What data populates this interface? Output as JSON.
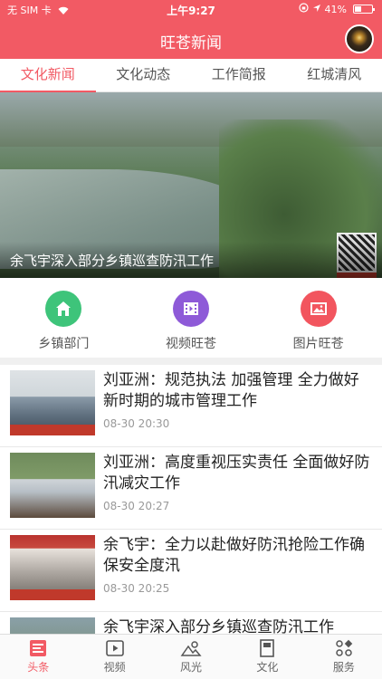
{
  "status_bar": {
    "carrier": "无 SIM 卡",
    "time": "上午9:27",
    "battery": "41%",
    "battery_level": 0.41
  },
  "header": {
    "title": "旺苍新闻"
  },
  "tabs": [
    {
      "label": "文化新闻",
      "active": true
    },
    {
      "label": "文化动态",
      "active": false
    },
    {
      "label": "工作简报",
      "active": false
    },
    {
      "label": "红城清风",
      "active": false
    }
  ],
  "hero": {
    "caption": "余飞宇深入部分乡镇巡查防汛工作"
  },
  "quick_links": [
    {
      "label": "乡镇部门",
      "color": "#3ec47a",
      "icon": "home-icon"
    },
    {
      "label": "视频旺苍",
      "color": "#8e5ad8",
      "icon": "film-icon"
    },
    {
      "label": "图片旺苍",
      "color": "#f2555e",
      "icon": "image-icon"
    }
  ],
  "news": [
    {
      "title": "刘亚洲：规范执法 加强管理 全力做好新时期的城市管理工作",
      "time": "08-30 20:30"
    },
    {
      "title": "刘亚洲：高度重视压实责任  全面做好防汛减灾工作",
      "time": "08-30 20:27"
    },
    {
      "title": "余飞宇：全力以赴做好防汛抢险工作确保安全度汛",
      "time": "08-30 20:25"
    },
    {
      "title": "余飞宇深入部分乡镇巡查防汛工作",
      "time": ""
    }
  ],
  "tabbar": [
    {
      "label": "头条",
      "icon": "headline-icon",
      "active": true
    },
    {
      "label": "视频",
      "icon": "video-icon",
      "active": false
    },
    {
      "label": "风光",
      "icon": "landscape-icon",
      "active": false
    },
    {
      "label": "文化",
      "icon": "book-icon",
      "active": false
    },
    {
      "label": "服务",
      "icon": "grid-icon",
      "active": false
    }
  ],
  "colors": {
    "brand": "#f25a64",
    "accent_green": "#3ec47a",
    "accent_purple": "#8e5ad8",
    "accent_red": "#f2555e"
  }
}
